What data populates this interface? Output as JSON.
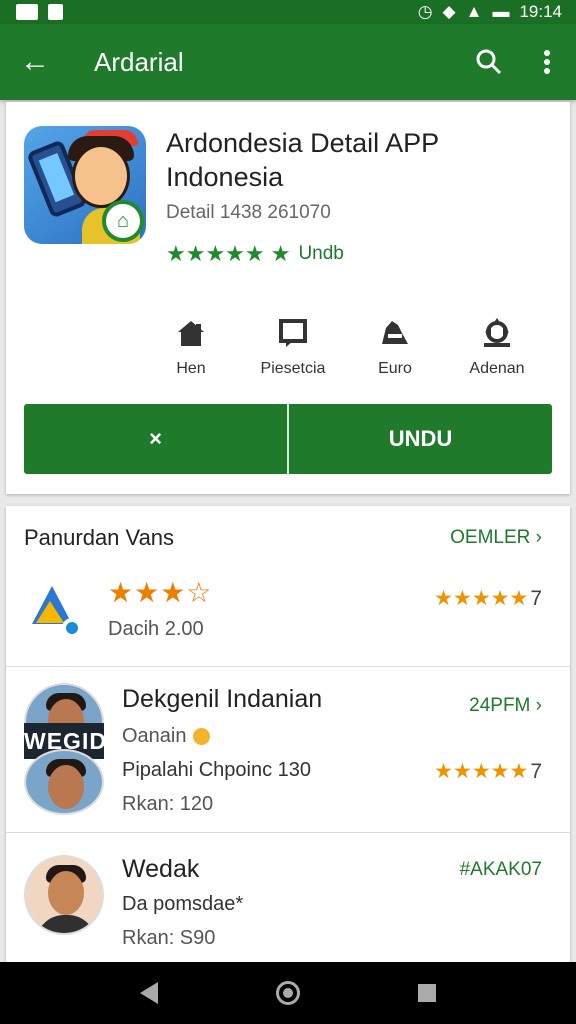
{
  "status": {
    "time": "19:14"
  },
  "app_bar": {
    "title": "Ardarial"
  },
  "app": {
    "title": "Ardondesia Detail APP Indonesia",
    "meta": "Detail 1438 261070",
    "stars": "★★★★★ ★",
    "rating_label": "Undb"
  },
  "actions": [
    {
      "label": "Hen",
      "icon": "home-icon"
    },
    {
      "label": "Piesetcia",
      "icon": "chat-icon"
    },
    {
      "label": "Euro",
      "icon": "car-icon"
    },
    {
      "label": "Adenan",
      "icon": "settings-icon"
    }
  ],
  "buttons": {
    "close_label": "×",
    "install_label": "UNDU"
  },
  "section": {
    "title": "Panurdan Vans",
    "link": "OEMLER ›"
  },
  "rows": [
    {
      "stars": "★★★☆",
      "sub": "Dacih 2.00",
      "right_stars": "★★★★★",
      "right_num": "7"
    },
    {
      "title": "Dekgenil Indanian",
      "line1": "Oanain",
      "line2": "Pipalahi Chpoinc 130",
      "line3": "Rkan: 120",
      "link": "24PFM ›",
      "overlay": "WEGID AKU",
      "right_stars": "★★★★★",
      "right_num": "7"
    },
    {
      "title": "Wedak",
      "line1": "Da pomsdae*",
      "line2": "Rkan: S90",
      "link": "#AKAK07"
    }
  ]
}
